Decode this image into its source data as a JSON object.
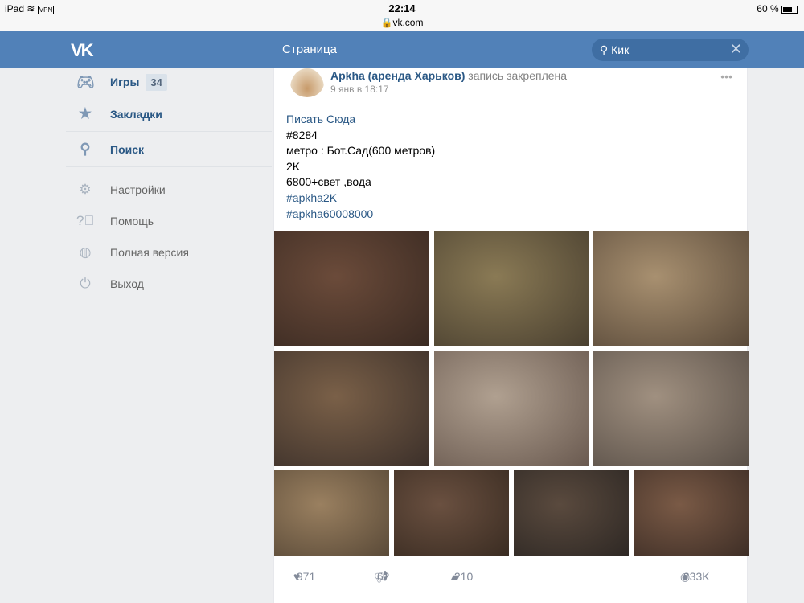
{
  "status_bar": {
    "device": "iPad",
    "vpn": "VPN",
    "time": "22:14",
    "url": "vk.com",
    "battery": "60 %",
    "battery_level": 0.6
  },
  "header": {
    "logo": "VK",
    "title": "Страница",
    "search_value": "Кик"
  },
  "sidebar": {
    "main_items": [
      {
        "label": "Игры",
        "badge": "34",
        "icon": "gamepad-icon"
      },
      {
        "label": "Закладки",
        "icon": "star-icon"
      },
      {
        "label": "Поиск",
        "icon": "search-icon"
      }
    ],
    "secondary_items": [
      {
        "label": "Настройки",
        "icon": "gear-icon"
      },
      {
        "label": "Помощь",
        "icon": "help-icon"
      },
      {
        "label": "Полная версия",
        "icon": "globe-icon"
      },
      {
        "label": "Выход",
        "icon": "power-icon"
      }
    ]
  },
  "post": {
    "author": "Apkha (аренда Харьков)",
    "action": "запись закреплена",
    "date": "9 янв в 18:17",
    "lines": [
      {
        "text": "Писать Сюда",
        "link": true
      },
      {
        "text": "#8284"
      },
      {
        "text": "метро : Бот.Сад(600 метров)"
      },
      {
        "text": "2K"
      },
      {
        "text": "6800+свет ,вода"
      },
      {
        "text": "#apkha2K",
        "link": true
      },
      {
        "text": "#apkha60008000",
        "link": true
      }
    ],
    "photo_count": 10,
    "likes": "971",
    "reposts": "62",
    "comments": "210",
    "views": "233K"
  }
}
